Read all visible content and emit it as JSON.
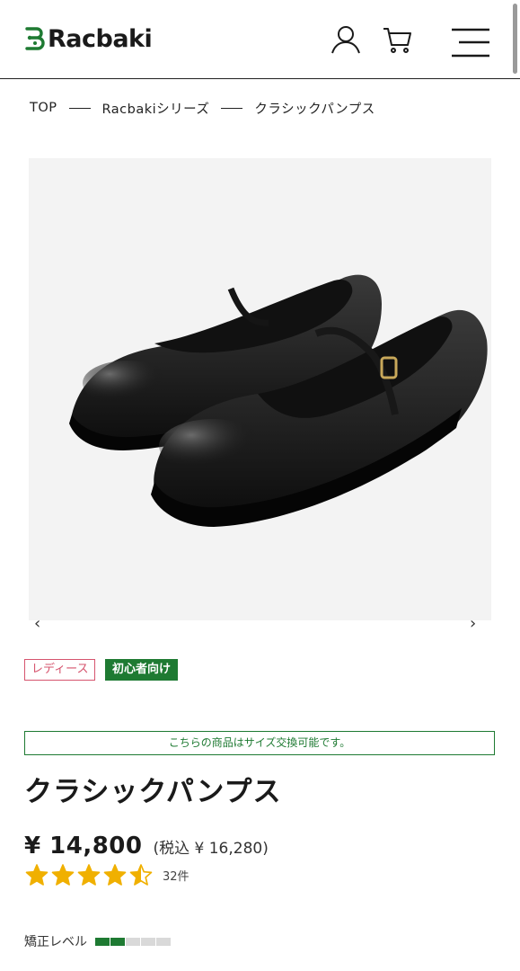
{
  "header": {
    "logo_text": "Racbaki",
    "accent_color": "#1e7a32"
  },
  "breadcrumb": {
    "items": [
      "TOP",
      "Racbakiシリーズ",
      "クラシックパンプス"
    ]
  },
  "gallery": {
    "prev_icon": "‹",
    "next_icon": "›"
  },
  "tags": {
    "ladies": "レディース",
    "beginner": "初心者向け"
  },
  "notice": "こちらの商品はサイズ交換可能です。",
  "product": {
    "title": "クラシックパンプス",
    "price": "¥ 14,800",
    "price_tax": "(税込 ¥ 16,280)",
    "rating": 4.5,
    "rating_max": 5,
    "review_count": "32件"
  },
  "correction_level": {
    "label": "矯正レベル",
    "level": 2,
    "max": 5,
    "active_color": "#1e7a32",
    "inactive_color": "#d9d9d9"
  }
}
